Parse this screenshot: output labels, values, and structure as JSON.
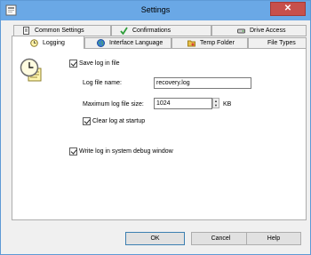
{
  "window": {
    "title": "Settings"
  },
  "tabs_row1": [
    {
      "label": "Common Settings",
      "icon": "document-icon"
    },
    {
      "label": "Confirmations",
      "icon": "checkmark-icon"
    },
    {
      "label": "Drive Access",
      "icon": "drive-icon"
    }
  ],
  "tabs_row2": [
    {
      "label": "Logging",
      "icon": "logging-icon",
      "active": true
    },
    {
      "label": "Interface Language",
      "icon": "globe-icon"
    },
    {
      "label": "Temp Folder",
      "icon": "folder-icon"
    },
    {
      "label": "File Types"
    }
  ],
  "logging": {
    "save_log_label": "Save log in file",
    "save_log_checked": true,
    "log_name_label": "Log file name:",
    "log_name_value": "recovery.log",
    "max_size_label": "Maximum log file size:",
    "max_size_value": "1024",
    "max_size_unit": "KB",
    "clear_label": "Clear log at startup",
    "clear_checked": true,
    "debug_label": "Write log in system debug window",
    "debug_checked": true
  },
  "buttons": {
    "ok": "OK",
    "cancel": "Cancel",
    "help": "Help"
  },
  "colors": {
    "titlebar": "#6aa8e6",
    "close": "#c7504b",
    "panel": "#ffffff"
  }
}
